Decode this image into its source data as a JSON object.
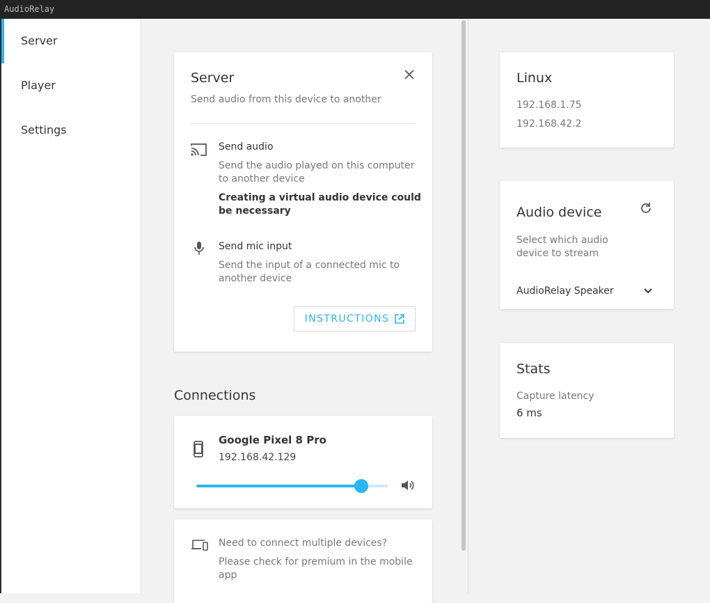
{
  "app": {
    "window_title": "AudioRelay"
  },
  "sidebar": {
    "items": [
      {
        "label": "Server",
        "active": true
      },
      {
        "label": "Player",
        "active": false
      },
      {
        "label": "Settings",
        "active": false
      }
    ]
  },
  "server_card": {
    "title": "Server",
    "subtitle": "Send audio from this device to another",
    "send_audio": {
      "title": "Send audio",
      "desc_line1": "Send the audio played on this computer",
      "desc_line2": "to another device",
      "note_line1": "Creating a virtual audio device could",
      "note_line2": "be necessary"
    },
    "send_mic": {
      "title": "Send mic input",
      "desc_line1": "Send the input of a connected mic to",
      "desc_line2": "another device"
    },
    "instructions_label": "INSTRUCTIONS"
  },
  "connections": {
    "heading": "Connections",
    "device": {
      "name": "Google Pixel 8 Pro",
      "ip": "192.168.42.129",
      "volume_fraction": 0.86
    },
    "premium": {
      "line1": "Need to connect multiple devices?",
      "line2": "Please check for premium in the mobile",
      "line3": "app"
    }
  },
  "host_card": {
    "title": "Linux",
    "ips": [
      "192.168.1.75",
      "192.168.42.2"
    ]
  },
  "audio_device_card": {
    "title": "Audio device",
    "desc_line1": "Select which audio",
    "desc_line2": "device to stream",
    "selected_device": "AudioRelay Speaker"
  },
  "stats_card": {
    "title": "Stats",
    "latency_label": "Capture latency",
    "latency_value": "6 ms"
  },
  "colors": {
    "accent": "#29b6f6",
    "titlebar": "#232323",
    "background": "#f2f2f2"
  }
}
